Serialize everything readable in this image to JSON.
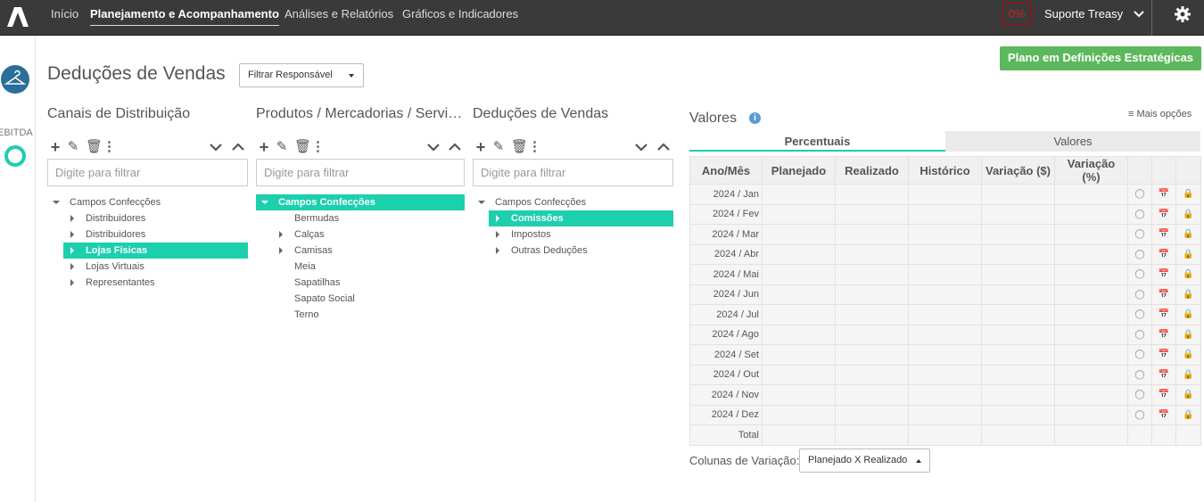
{
  "nav": {
    "inicio": "Início",
    "planejamento": "Planejamento e Acompanhamento",
    "analises": "Análises e Relatórios",
    "graficos": "Gráficos e Indicadores"
  },
  "pct_indicator": "0%",
  "user_name": "Suporte Treasy",
  "rail": {
    "label": "EBITDA"
  },
  "page_title": "Deduções de Vendas",
  "filter_responsavel": "Filtrar Responsável",
  "strategic_button": "Plano em Definições Estratégicas",
  "columns": [
    {
      "title": "Canais de Distribuição",
      "filter_placeholder": "Digite para filtrar",
      "tree": [
        {
          "label": "Campos Confecções",
          "level": 0,
          "expander": "down",
          "selected": false
        },
        {
          "label": "Distribuidores",
          "level": 1,
          "expander": "right",
          "selected": false
        },
        {
          "label": "Distribuidores",
          "level": 1,
          "expander": "right",
          "selected": false
        },
        {
          "label": "Lojas Físicas",
          "level": 1,
          "expander": "right",
          "selected": true
        },
        {
          "label": "Lojas Virtuais",
          "level": 1,
          "expander": "right",
          "selected": false
        },
        {
          "label": "Representantes",
          "level": 1,
          "expander": "right",
          "selected": false
        }
      ]
    },
    {
      "title": "Produtos / Mercadorias / Serviços",
      "filter_placeholder": "Digite para filtrar",
      "tree": [
        {
          "label": "Campos Confecções",
          "level": 0,
          "expander": "down",
          "selected": true
        },
        {
          "label": "Bermudas",
          "level": 1,
          "expander": "none",
          "selected": false
        },
        {
          "label": "Calças",
          "level": 1,
          "expander": "right",
          "selected": false
        },
        {
          "label": "Camisas",
          "level": 1,
          "expander": "right",
          "selected": false
        },
        {
          "label": "Meia",
          "level": 1,
          "expander": "none",
          "selected": false
        },
        {
          "label": "Sapatilhas",
          "level": 1,
          "expander": "none",
          "selected": false
        },
        {
          "label": "Sapato Social",
          "level": 1,
          "expander": "none",
          "selected": false
        },
        {
          "label": "Terno",
          "level": 1,
          "expander": "none",
          "selected": false
        }
      ]
    },
    {
      "title": "Deduções de Vendas",
      "filter_placeholder": "Digite para filtrar",
      "tree": [
        {
          "label": "Campos Confecções",
          "level": 0,
          "expander": "down",
          "selected": false
        },
        {
          "label": "Comissões",
          "level": 1,
          "expander": "right",
          "selected": true
        },
        {
          "label": "Impostos",
          "level": 1,
          "expander": "right",
          "selected": false
        },
        {
          "label": "Outras Deduções",
          "level": 1,
          "expander": "right",
          "selected": false
        }
      ]
    }
  ],
  "valores": {
    "title": "Valores",
    "mais_opcoes": "Mais opções",
    "tabs": [
      "Percentuais",
      "Valores"
    ],
    "headers": [
      "Ano/Mês",
      "Planejado",
      "Realizado",
      "Histórico",
      "Variação ($)",
      "Variação (%)"
    ],
    "rows": [
      "2024 / Jan",
      "2024 / Fev",
      "2024 / Mar",
      "2024 / Abr",
      "2024 / Mai",
      "2024 / Jun",
      "2024 / Jul",
      "2024 / Ago",
      "2024 / Set",
      "2024 / Out",
      "2024 / Nov",
      "2024 / Dez"
    ],
    "total_label": "Total"
  },
  "colunas_variacao": {
    "label": "Colunas de Variação:",
    "value": "Planejado X Realizado"
  }
}
